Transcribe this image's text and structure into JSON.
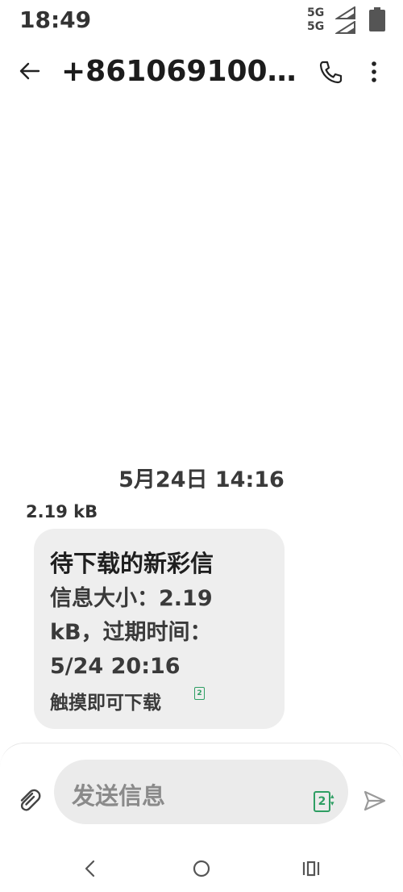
{
  "status_bar": {
    "time": "18:49",
    "network_top": "5G",
    "network_bottom": "5G",
    "icons": [
      "signal-icon",
      "signal-icon",
      "battery-icon"
    ]
  },
  "header": {
    "title": "+8610691000...",
    "icons": [
      "back-arrow-icon",
      "phone-icon",
      "more-vertical-icon"
    ]
  },
  "conversation": {
    "date_separator": "5月24日 14:16",
    "message_size": "2.19 kB",
    "bubble": {
      "title": "待下载的新彩信",
      "info": "信息大小：2.19 kB，过期时间：5/24 20:16",
      "action": "触摸即可下载",
      "sim_number": "2"
    }
  },
  "composer": {
    "placeholder": "发送信息",
    "sim_number": "2",
    "icons": [
      "attachment-icon",
      "sim-switch-icon",
      "send-icon"
    ]
  },
  "nav_bar": {
    "icons": [
      "nav-back-icon",
      "nav-home-icon",
      "nav-recents-icon"
    ]
  },
  "colors": {
    "accent": "#2e9e63",
    "bubble_bg": "#eeeeee",
    "composer_bg": "#ebebeb"
  }
}
